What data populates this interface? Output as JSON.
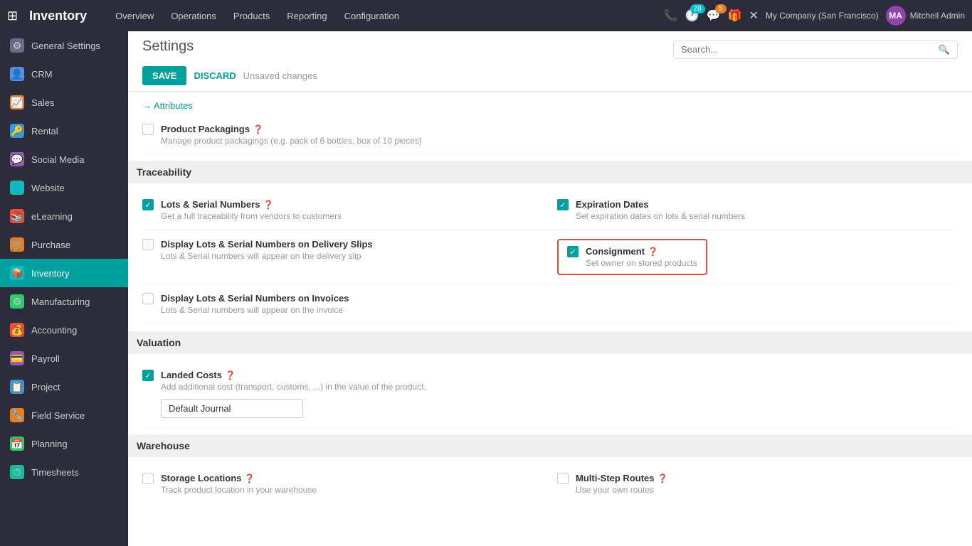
{
  "app": {
    "title": "Inventory",
    "grid_icon": "⊞"
  },
  "nav": {
    "menu": [
      "Overview",
      "Operations",
      "Products",
      "Reporting",
      "Configuration"
    ],
    "company": "My Company (San Francisco)",
    "user": "Mitchell Admin",
    "badge_28": "28",
    "badge_5": "5"
  },
  "sidebar": {
    "items": [
      {
        "id": "general-settings",
        "label": "General Settings",
        "icon": "⚙",
        "icon_class": "icon-general"
      },
      {
        "id": "crm",
        "label": "CRM",
        "icon": "👤",
        "icon_class": "icon-crm"
      },
      {
        "id": "sales",
        "label": "Sales",
        "icon": "📈",
        "icon_class": "icon-sales"
      },
      {
        "id": "rental",
        "label": "Rental",
        "icon": "🔑",
        "icon_class": "icon-rental"
      },
      {
        "id": "social-media",
        "label": "Social Media",
        "icon": "💬",
        "icon_class": "icon-social"
      },
      {
        "id": "website",
        "label": "Website",
        "icon": "🌐",
        "icon_class": "icon-website"
      },
      {
        "id": "elearning",
        "label": "eLearning",
        "icon": "📚",
        "icon_class": "icon-elearning"
      },
      {
        "id": "purchase",
        "label": "Purchase",
        "icon": "🛒",
        "icon_class": "icon-purchase"
      },
      {
        "id": "inventory",
        "label": "Inventory",
        "icon": "📦",
        "icon_class": "icon-inventory"
      },
      {
        "id": "manufacturing",
        "label": "Manufacturing",
        "icon": "⚙",
        "icon_class": "icon-manufacturing"
      },
      {
        "id": "accounting",
        "label": "Accounting",
        "icon": "💰",
        "icon_class": "icon-accounting"
      },
      {
        "id": "payroll",
        "label": "Payroll",
        "icon": "💳",
        "icon_class": "icon-payroll"
      },
      {
        "id": "project",
        "label": "Project",
        "icon": "📋",
        "icon_class": "icon-project"
      },
      {
        "id": "field-service",
        "label": "Field Service",
        "icon": "🔧",
        "icon_class": "icon-fieldservice"
      },
      {
        "id": "planning",
        "label": "Planning",
        "icon": "📅",
        "icon_class": "icon-planning"
      },
      {
        "id": "timesheets",
        "label": "Timesheets",
        "icon": "⏱",
        "icon_class": "icon-timesheets"
      }
    ]
  },
  "settings": {
    "title": "Settings",
    "save_label": "SAVE",
    "discard_label": "DISCARD",
    "unsaved_label": "Unsaved changes"
  },
  "search": {
    "placeholder": "Search..."
  },
  "attributes_link": "→ Attributes",
  "sections": {
    "traceability": {
      "title": "Traceability",
      "items_left": [
        {
          "id": "lots-serial",
          "label": "Lots & Serial Numbers",
          "desc": "Get a full traceability from vendors to customers",
          "checked": true
        },
        {
          "id": "display-lots-delivery",
          "label": "Display Lots & Serial Numbers on Delivery Slips",
          "desc": "Lots & Serial numbers will appear on the delivery slip",
          "checked": false
        },
        {
          "id": "display-lots-invoices",
          "label": "Display Lots & Serial Numbers on Invoices",
          "desc": "Lots & Serial numbers will appear on the invoice",
          "checked": false
        }
      ],
      "items_right": [
        {
          "id": "expiration-dates",
          "label": "Expiration Dates",
          "desc": "Set expiration dates on lots & serial numbers",
          "checked": true
        },
        {
          "id": "consignment",
          "label": "Consignment",
          "desc": "Set owner on stored products",
          "checked": true,
          "highlighted": true
        }
      ]
    },
    "product_packagings": {
      "id": "product-packagings",
      "label": "Product Packagings",
      "desc": "Manage product packagings (e.g. pack of 6 bottles, box of 10 pieces)",
      "checked": false
    },
    "valuation": {
      "title": "Valuation",
      "landed_costs": {
        "id": "landed-costs",
        "label": "Landed Costs",
        "desc": "Add additional cost (transport, customs, ...) in the value of the product.",
        "checked": true
      },
      "default_journal_label": "Default Journal",
      "default_journal_placeholder": ""
    },
    "warehouse": {
      "title": "Warehouse",
      "items_left": [
        {
          "id": "storage-locations",
          "label": "Storage Locations",
          "desc": "Track product location in your warehouse",
          "checked": false
        }
      ],
      "items_right": [
        {
          "id": "multi-step-routes",
          "label": "Multi-Step Routes",
          "desc": "Use your own routes",
          "checked": false
        }
      ]
    }
  }
}
